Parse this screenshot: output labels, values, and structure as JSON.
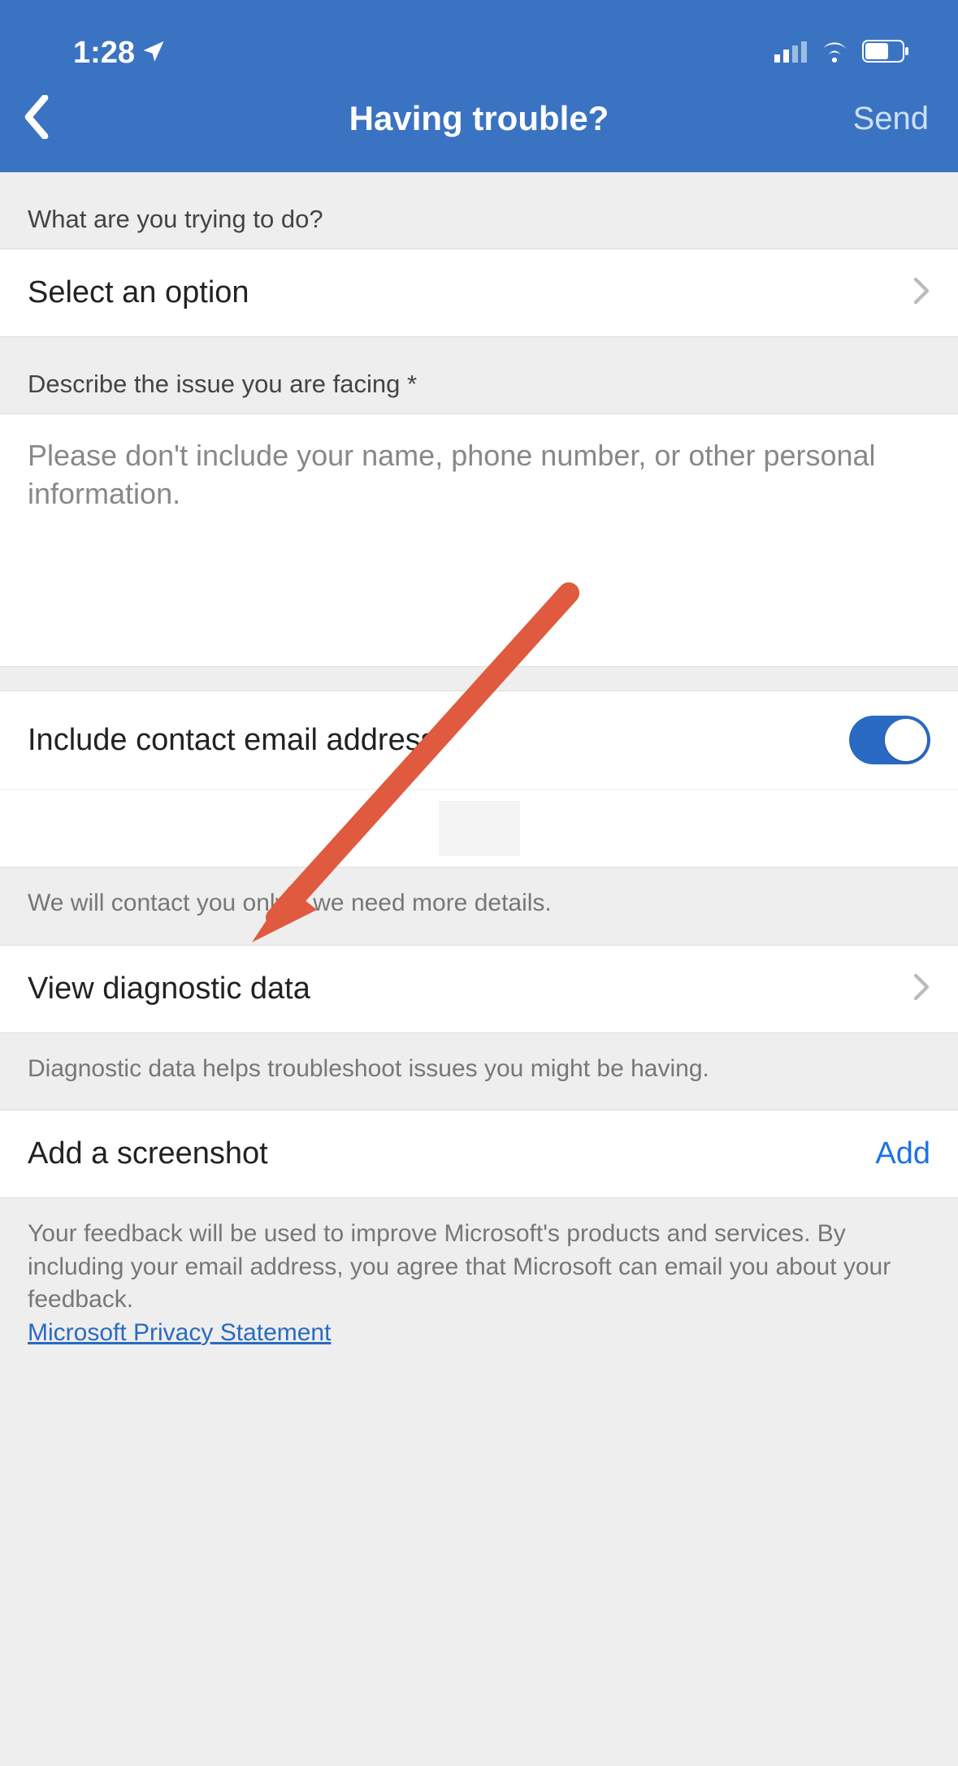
{
  "status": {
    "time": "1:28",
    "location_icon": "location-arrow"
  },
  "nav": {
    "title": "Having trouble?",
    "send": "Send"
  },
  "section1": {
    "label": "What are you trying to do?",
    "select_placeholder": "Select an option"
  },
  "section2": {
    "label": "Describe the issue you are facing *",
    "textarea_placeholder": "Please don't include your name, phone number, or other personal information."
  },
  "contact": {
    "toggle_label": "Include contact email address",
    "note": "We will contact you only if we need more details."
  },
  "diagnostic": {
    "row_label": "View diagnostic data",
    "note": "Diagnostic data helps troubleshoot issues you might be having."
  },
  "screenshot": {
    "row_label": "Add a screenshot",
    "add": "Add"
  },
  "footer": {
    "text": "Your feedback will be used to improve Microsoft's products and services. By including your email address, you agree that Microsoft can email you about your feedback.",
    "link": "Microsoft Privacy Statement"
  }
}
